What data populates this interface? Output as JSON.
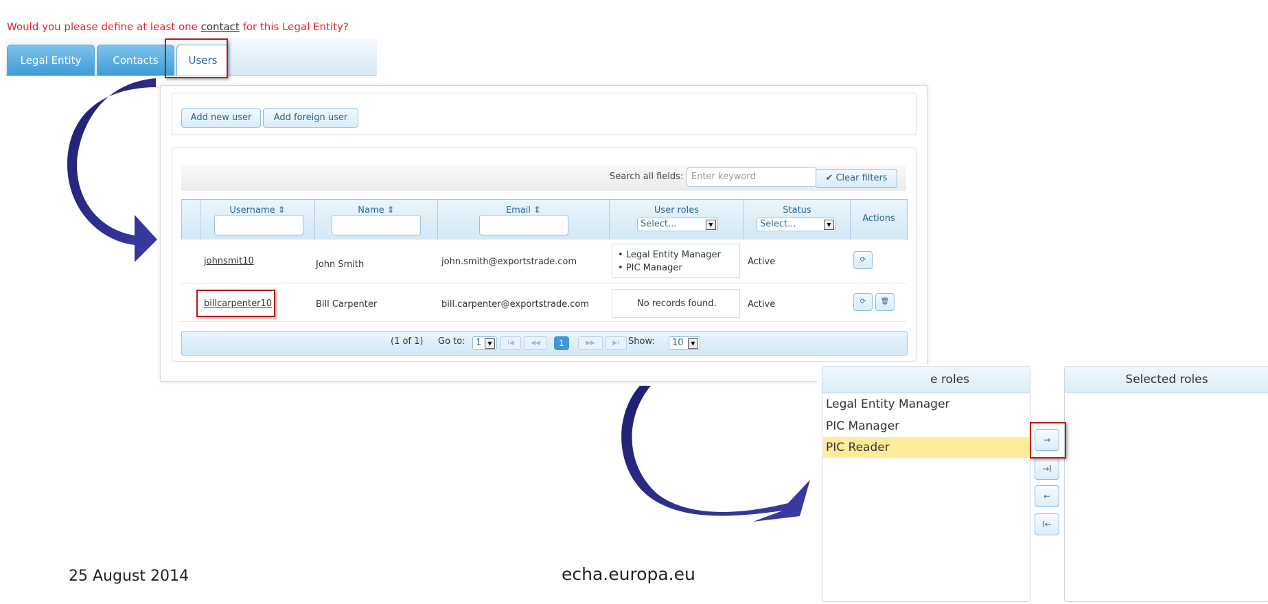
{
  "warning": {
    "prefix": "Would you please define at least one ",
    "link": "contact",
    "suffix": " for this Legal Entity?"
  },
  "tabs": [
    {
      "label": "Legal Entity"
    },
    {
      "label": "Contacts"
    },
    {
      "label": "Users"
    }
  ],
  "toolbar": {
    "add_new_user": "Add new user",
    "add_foreign_user": "Add foreign user"
  },
  "search": {
    "label": "Search all fields:",
    "placeholder": "Enter keyword",
    "clear_filters": "Clear filters"
  },
  "columns": {
    "username": "Username",
    "name": "Name",
    "email": "Email",
    "user_roles": "User roles",
    "status": "Status",
    "actions": "Actions",
    "select": "Select..."
  },
  "rows": [
    {
      "username": "johnsmit10",
      "name": "John Smith",
      "email": "john.smith@exportstrade.com",
      "roles": [
        "Legal Entity Manager",
        "PIC Manager"
      ],
      "status": "Active"
    },
    {
      "username": "billcarpenter10",
      "name": "Bill Carpenter",
      "email": "bill.carpenter@exportstrade.com",
      "roles_empty": "No records found.",
      "status": "Active"
    }
  ],
  "pager": {
    "summary": "(1 of 1)",
    "goto_label": "Go to:",
    "goto_value": "1",
    "current_page": "1",
    "show_label": "Show:",
    "show_value": "10"
  },
  "roles_picker": {
    "available_header": "e roles",
    "selected_header": "Selected roles",
    "available": [
      "Legal Entity Manager",
      "PIC Manager",
      "PIC Reader"
    ],
    "highlighted": "PIC Reader",
    "buttons": [
      "→",
      "→I",
      "←",
      "I←"
    ]
  },
  "footer": {
    "date": "25 August 2014",
    "url": "echa.europa.eu"
  },
  "colors": {
    "accent": "#3d98d6",
    "warning": "#e8202a",
    "highlight_box": "#c0151b",
    "arrow": "#2c2c86",
    "selected_row": "#ffec9a"
  }
}
